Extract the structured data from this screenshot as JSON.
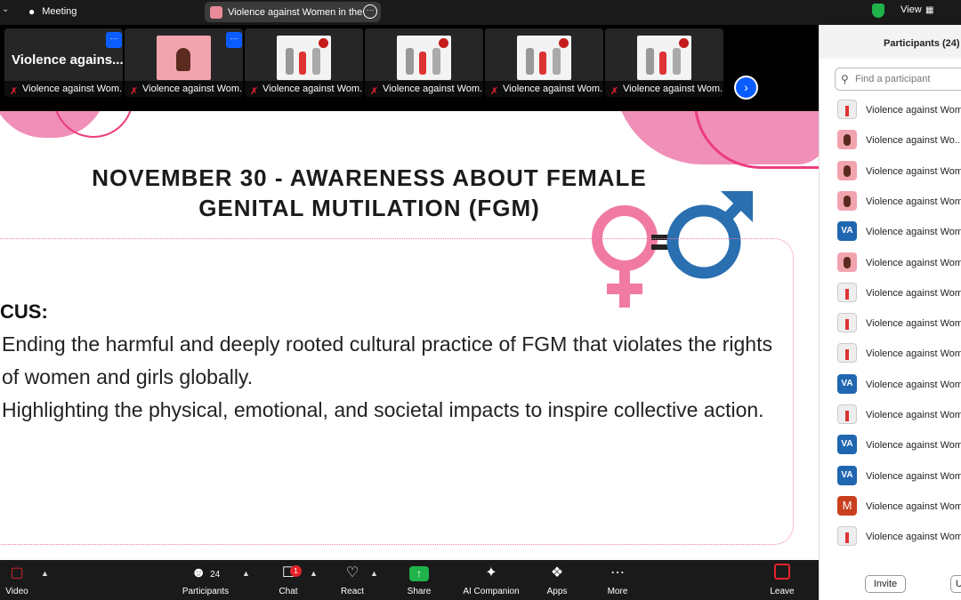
{
  "topbar": {
    "meeting_label": "Meeting",
    "tab_title": "Violence against Women in the V",
    "view_label": "View"
  },
  "strip": {
    "first_tile_big": "Violence agains...",
    "tile_names": [
      "Violence against Wom...",
      "Violence against Wom...",
      "Violence against Wom...",
      "Violence against Wom...",
      "Violence against Wom...",
      "Violence against Wom..."
    ],
    "tile_more": "···"
  },
  "slide": {
    "title_line1": "NOVEMBER 30 - AWARENESS ABOUT FEMALE",
    "title_line2": "GENITAL MUTILATION (FGM)",
    "focus_label": "CUS:",
    "bullet1": "Ending the harmful and deeply rooted cultural practice of FGM that violates the rights of women and girls globally.",
    "bullet2": "Highlighting the physical, emotional, and societal impacts to inspire collective action."
  },
  "bottombar": {
    "video": "Video",
    "participants": "Participants",
    "participant_count": "24",
    "chat": "Chat",
    "chat_badge": "1",
    "react": "React",
    "share": "Share",
    "ai_companion": "AI Companion",
    "apps": "Apps",
    "more": "More",
    "leave": "Leave"
  },
  "panel": {
    "title": "Participants (24)",
    "search_placeholder": "Find a participant",
    "invite": "Invite",
    "invite2": "U",
    "participants": [
      {
        "avatar": "poster",
        "name": "Violence against Wome"
      },
      {
        "avatar": "pink",
        "name": "Violence against Wo..."
      },
      {
        "avatar": "pink",
        "name": "Violence against Wom..."
      },
      {
        "avatar": "pink",
        "name": "Violence against Wom..."
      },
      {
        "avatar": "va",
        "initials": "VA",
        "name": "Violence against Wome"
      },
      {
        "avatar": "pink",
        "name": "Violence against Wome"
      },
      {
        "avatar": "poster",
        "name": "Violence against Wome"
      },
      {
        "avatar": "poster",
        "name": "Violence against Wome"
      },
      {
        "avatar": "poster",
        "name": "Violence against Wome"
      },
      {
        "avatar": "va",
        "initials": "VA",
        "name": "Violence against Wome"
      },
      {
        "avatar": "poster",
        "name": "Violence against Wome"
      },
      {
        "avatar": "va",
        "initials": "VA",
        "name": "Violence against Wome"
      },
      {
        "avatar": "va",
        "initials": "VA",
        "name": "Violence against Wome"
      },
      {
        "avatar": "m",
        "initials": "M",
        "name": "Violence against Wome"
      },
      {
        "avatar": "poster",
        "name": "Violence against Wome"
      }
    ]
  },
  "colors": {
    "accent_blue": "#0b5cff",
    "pink": "#f08fb8",
    "female_symbol": "#f07aa3",
    "male_symbol": "#2a6fb0"
  }
}
